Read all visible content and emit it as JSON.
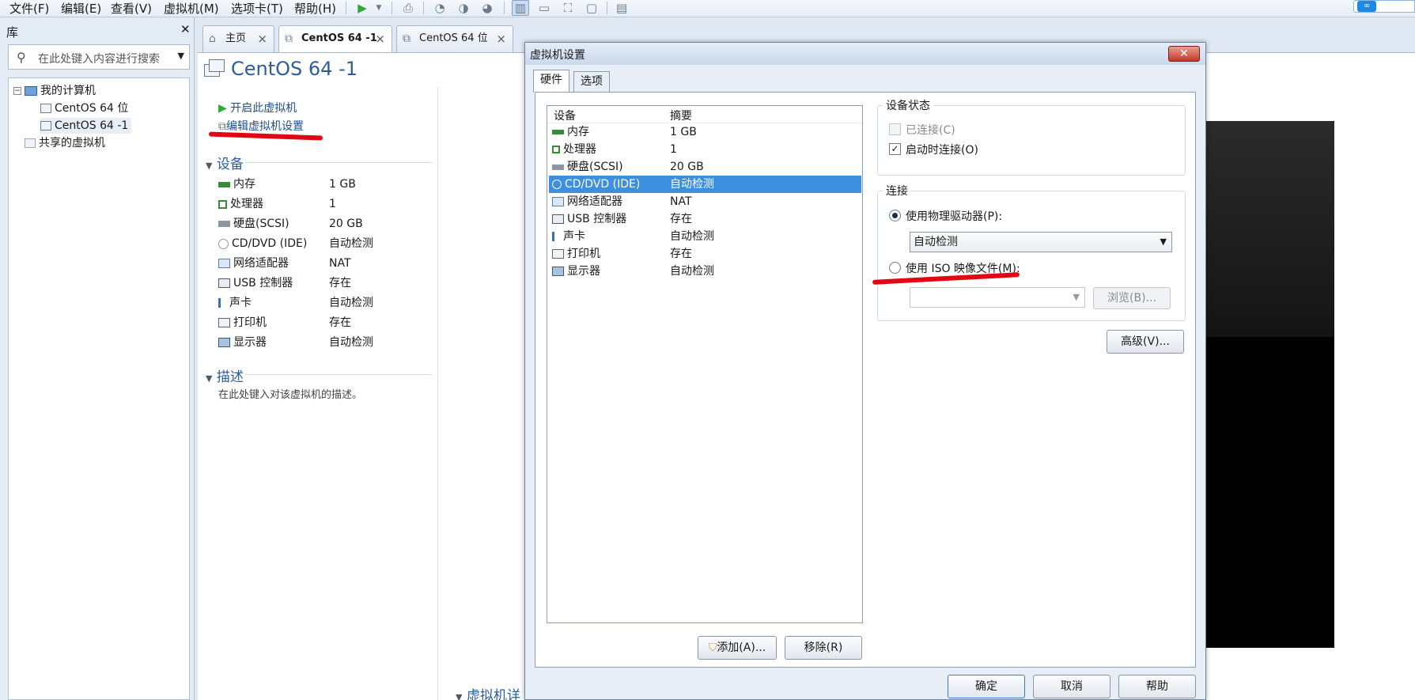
{
  "menubar": {
    "items": [
      "文件(F)",
      "编辑(E)",
      "查看(V)",
      "虚拟机(M)",
      "选项卡(T)",
      "帮助(H)"
    ]
  },
  "library": {
    "title": "库",
    "search_placeholder": "在此处键入内容进行搜索",
    "tree": {
      "root": "我的计算机",
      "vms": [
        "CentOS 64 位",
        "CentOS 64 -1"
      ],
      "shared": "共享的虚拟机"
    }
  },
  "tabs": [
    {
      "label": "主页"
    },
    {
      "label": "CentOS 64 -1"
    },
    {
      "label": "CentOS 64 位"
    }
  ],
  "vm": {
    "title": "CentOS 64 -1",
    "actions": {
      "start": "开启此虚拟机",
      "edit": "编辑虚拟机设置"
    },
    "devices_heading": "设备",
    "devices": [
      {
        "name": "内存",
        "value": "1 GB",
        "icon": "memory-icon"
      },
      {
        "name": "处理器",
        "value": "1",
        "icon": "cpu-icon"
      },
      {
        "name": "硬盘(SCSI)",
        "value": "20 GB",
        "icon": "harddisk-icon"
      },
      {
        "name": "CD/DVD (IDE)",
        "value": "自动检测",
        "icon": "cdrom-icon"
      },
      {
        "name": "网络适配器",
        "value": "NAT",
        "icon": "network-icon"
      },
      {
        "name": "USB 控制器",
        "value": "存在",
        "icon": "usb-icon"
      },
      {
        "name": "声卡",
        "value": "自动检测",
        "icon": "sound-icon"
      },
      {
        "name": "打印机",
        "value": "存在",
        "icon": "printer-icon"
      },
      {
        "name": "显示器",
        "value": "自动检测",
        "icon": "display-icon"
      }
    ],
    "description_heading": "描述",
    "description_placeholder": "在此处键入对该虚拟机的描述。",
    "details_heading": "虚拟机详"
  },
  "dialog": {
    "title": "虚拟机设置",
    "tabs": [
      "硬件",
      "选项"
    ],
    "list_headers": {
      "device": "设备",
      "summary": "摘要"
    },
    "list": [
      {
        "name": "内存",
        "summary": "1 GB"
      },
      {
        "name": "处理器",
        "summary": "1"
      },
      {
        "name": "硬盘(SCSI)",
        "summary": "20 GB"
      },
      {
        "name": "CD/DVD (IDE)",
        "summary": "自动检测"
      },
      {
        "name": "网络适配器",
        "summary": "NAT"
      },
      {
        "name": "USB 控制器",
        "summary": "存在"
      },
      {
        "name": "声卡",
        "summary": "自动检测"
      },
      {
        "name": "打印机",
        "summary": "存在"
      },
      {
        "name": "显示器",
        "summary": "自动检测"
      }
    ],
    "selected_index": 3,
    "add_button": "添加(A)...",
    "remove_button": "移除(R)",
    "device_status": {
      "heading": "设备状态",
      "connected": "已连接(C)",
      "connect_at_power_on": "启动时连接(O)"
    },
    "connection": {
      "heading": "连接",
      "physical": "使用物理驱动器(P):",
      "physical_value": "自动检测",
      "iso": "使用 ISO 映像文件(M):",
      "iso_value": "",
      "browse": "浏览(B)..."
    },
    "advanced_button": "高级(V)...",
    "ok": "确定",
    "cancel": "取消",
    "help": "帮助"
  },
  "colors": {
    "annotation_red": "#e30613",
    "selection_blue": "#3d8fe0",
    "title_blue": "#2a5d9e"
  }
}
